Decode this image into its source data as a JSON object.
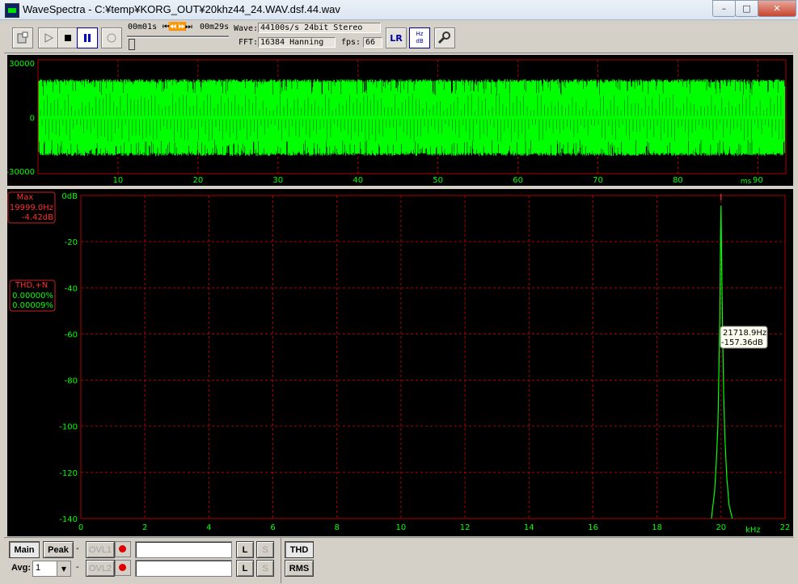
{
  "window": {
    "title": "WaveSpectra - C:¥temp¥KORG_OUT¥20khz44_24.WAV.dsf.44.wav",
    "minimize": "–",
    "maximize": "□",
    "close": "✕"
  },
  "toolbar": {
    "time_elapsed": "00m01s",
    "seek_glyphs": "⏮⏪⏩⏭",
    "time_total": "00m29s",
    "wave_label": "Wave:",
    "wave_value": "44100s/s 24bit Stereo",
    "fft_label": "FFT:",
    "fft_value": "16384 Hanning",
    "fps_label": "fps:",
    "fps_value": "66",
    "lr_button": "LR",
    "hzdb_top": "Hz",
    "hzdb_bottom": "dB"
  },
  "scope": {
    "y_ticks": [
      "30000",
      "0",
      "-30000"
    ],
    "x_ticks": [
      "10",
      "20",
      "30",
      "40",
      "50",
      "60",
      "70",
      "80",
      "90"
    ],
    "x_unit": "ms"
  },
  "spectrum": {
    "y_ticks": [
      "0dB",
      "-20",
      "-40",
      "-60",
      "-80",
      "-100",
      "-120",
      "-140"
    ],
    "x_ticks": [
      "0",
      "2",
      "4",
      "6",
      "8",
      "10",
      "12",
      "14",
      "16",
      "18",
      "20",
      "22"
    ],
    "x_unit": "kHz",
    "max_title": "Max",
    "max_freq": "19999.0Hz",
    "max_db": "-4.42dB",
    "thd_title": "THD,+N",
    "thd_value": "0.00000%",
    "thdn_value": "0.00009%",
    "cursor_freq": "21718.9Hz",
    "cursor_db": "-157.36dB"
  },
  "chart_data": {
    "type": "line",
    "xlabel": "kHz",
    "ylabel": "",
    "xlim": [
      0,
      22
    ],
    "ylim": [
      -140,
      0
    ],
    "series": [
      {
        "x": [
          19.7,
          19.8,
          19.85,
          19.9,
          19.93,
          19.96,
          19.98,
          19.999,
          20.02,
          20.05,
          20.08,
          20.12,
          20.18,
          20.25,
          20.35
        ],
        "values": [
          -140,
          -128,
          -116,
          -100,
          -80,
          -55,
          -25,
          -4.42,
          -30,
          -60,
          -85,
          -105,
          -122,
          -134,
          -140
        ]
      }
    ]
  },
  "colors": {
    "wave": "#00ff00",
    "grid": "#b00000",
    "axis_text": "#00ff00",
    "info_text": "#ff3030"
  },
  "bottom": {
    "main": "Main",
    "peak": "Peak",
    "dash1": "-",
    "ovl1": "OVL1",
    "ovl2": "OVL2",
    "dash2": "-",
    "avg_label": "Avg:",
    "avg_value": "1",
    "l1": "L",
    "s1": "S",
    "l2": "L",
    "s2": "S",
    "thd": "THD",
    "rms": "RMS"
  }
}
